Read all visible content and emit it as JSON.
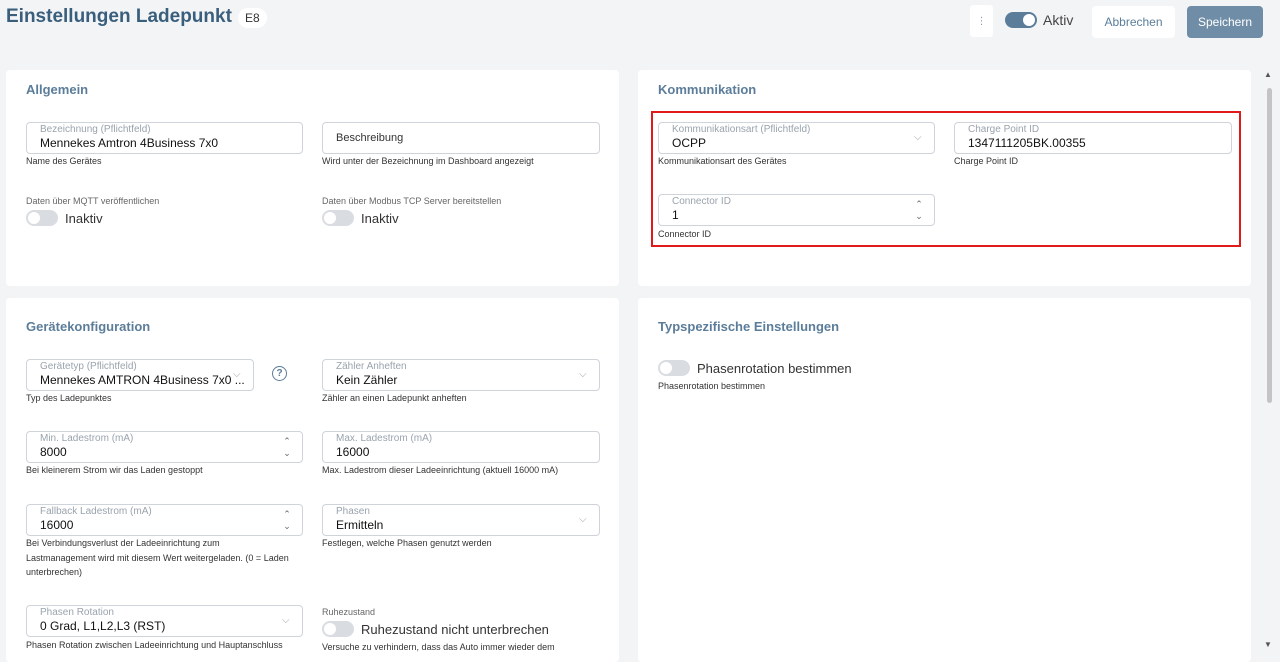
{
  "header": {
    "title": "Einstellungen Ladepunkt",
    "badge": "E8",
    "menu_icon": "vertical-dots-icon",
    "active_label": "Aktiv",
    "active_on": true,
    "cancel_label": "Abbrechen",
    "save_label": "Speichern"
  },
  "allgemein": {
    "title": "Allgemein",
    "name_field": {
      "label": "Bezeichnung (Pflichtfeld)",
      "value": "Mennekes Amtron 4Business 7x0",
      "hint": "Name des Gerätes"
    },
    "description_field": {
      "placeholder": "Beschreibung",
      "hint": "Wird unter der Bezeichnung im Dashboard angezeigt"
    },
    "mqtt": {
      "label": "Daten über MQTT veröffentlichen",
      "state": "Inaktiv"
    },
    "modbus": {
      "label": "Daten über Modbus TCP Server bereitstellen",
      "state": "Inaktiv"
    }
  },
  "kommunikation": {
    "title": "Kommunikation",
    "comm_type": {
      "label": "Kommunikationsart (Pflichtfeld)",
      "value": "OCPP",
      "hint": "Kommunikationsart des Gerätes"
    },
    "charge_point_id": {
      "label": "Charge Point ID",
      "value": "1347111205BK.00355",
      "hint": "Charge Point ID"
    },
    "connector_id": {
      "label": "Connector ID",
      "value": "1",
      "hint": "Connector ID"
    }
  },
  "geraetekonfiguration": {
    "title": "Gerätekonfiguration",
    "device_type": {
      "label": "Gerätetyp (Pflichtfeld)",
      "value": "Mennekes AMTRON 4Business 7x0 ...",
      "hint": "Typ des Ladepunktes"
    },
    "meter": {
      "label": "Zähler Anheften",
      "value": "Kein Zähler",
      "hint": "Zähler an einen Ladepunkt anheften"
    },
    "min_current": {
      "label": "Min. Ladestrom (mA)",
      "value": "8000",
      "hint": "Bei kleinerem Strom wir das Laden gestoppt"
    },
    "max_current": {
      "label": "Max. Ladestrom (mA)",
      "value": "16000",
      "hint": "Max. Ladestrom dieser Ladeeinrichtung (aktuell 16000 mA)"
    },
    "fallback_current": {
      "label": "Fallback Ladestrom (mA)",
      "value": "16000",
      "hint_1": "Bei Verbindungsverlust der Ladeeinrichtung zum",
      "hint_2": "Lastmanagement wird mit diesem Wert weitergeladen. (0 = Laden",
      "hint_3": "unterbrechen)"
    },
    "phases": {
      "label": "Phasen",
      "value": "Ermitteln",
      "hint": "Festlegen, welche Phasen genutzt werden"
    },
    "phase_rotation": {
      "label": "Phasen Rotation",
      "value": "0 Grad, L1,L2,L3 (RST)",
      "hint": "Phasen Rotation zwischen Ladeeinrichtung und Hauptanschluss"
    },
    "rest_state": {
      "label": "Ruhezustand",
      "state": "Ruhezustand nicht unterbrechen",
      "hint": "Versuche zu verhindern, dass das Auto immer wieder dem"
    }
  },
  "typspezifisch": {
    "title": "Typspezifische Einstellungen",
    "phase_rotation_toggle": {
      "label": "Phasenrotation bestimmen",
      "hint": "Phasenrotation bestimmen"
    }
  },
  "glyphs": {
    "chevron_down": "⌵",
    "spin_up": "⌃",
    "spin_down": "⌄",
    "help": "?",
    "dots": "⋮",
    "scroll_up": "▲",
    "scroll_down": "▼"
  }
}
